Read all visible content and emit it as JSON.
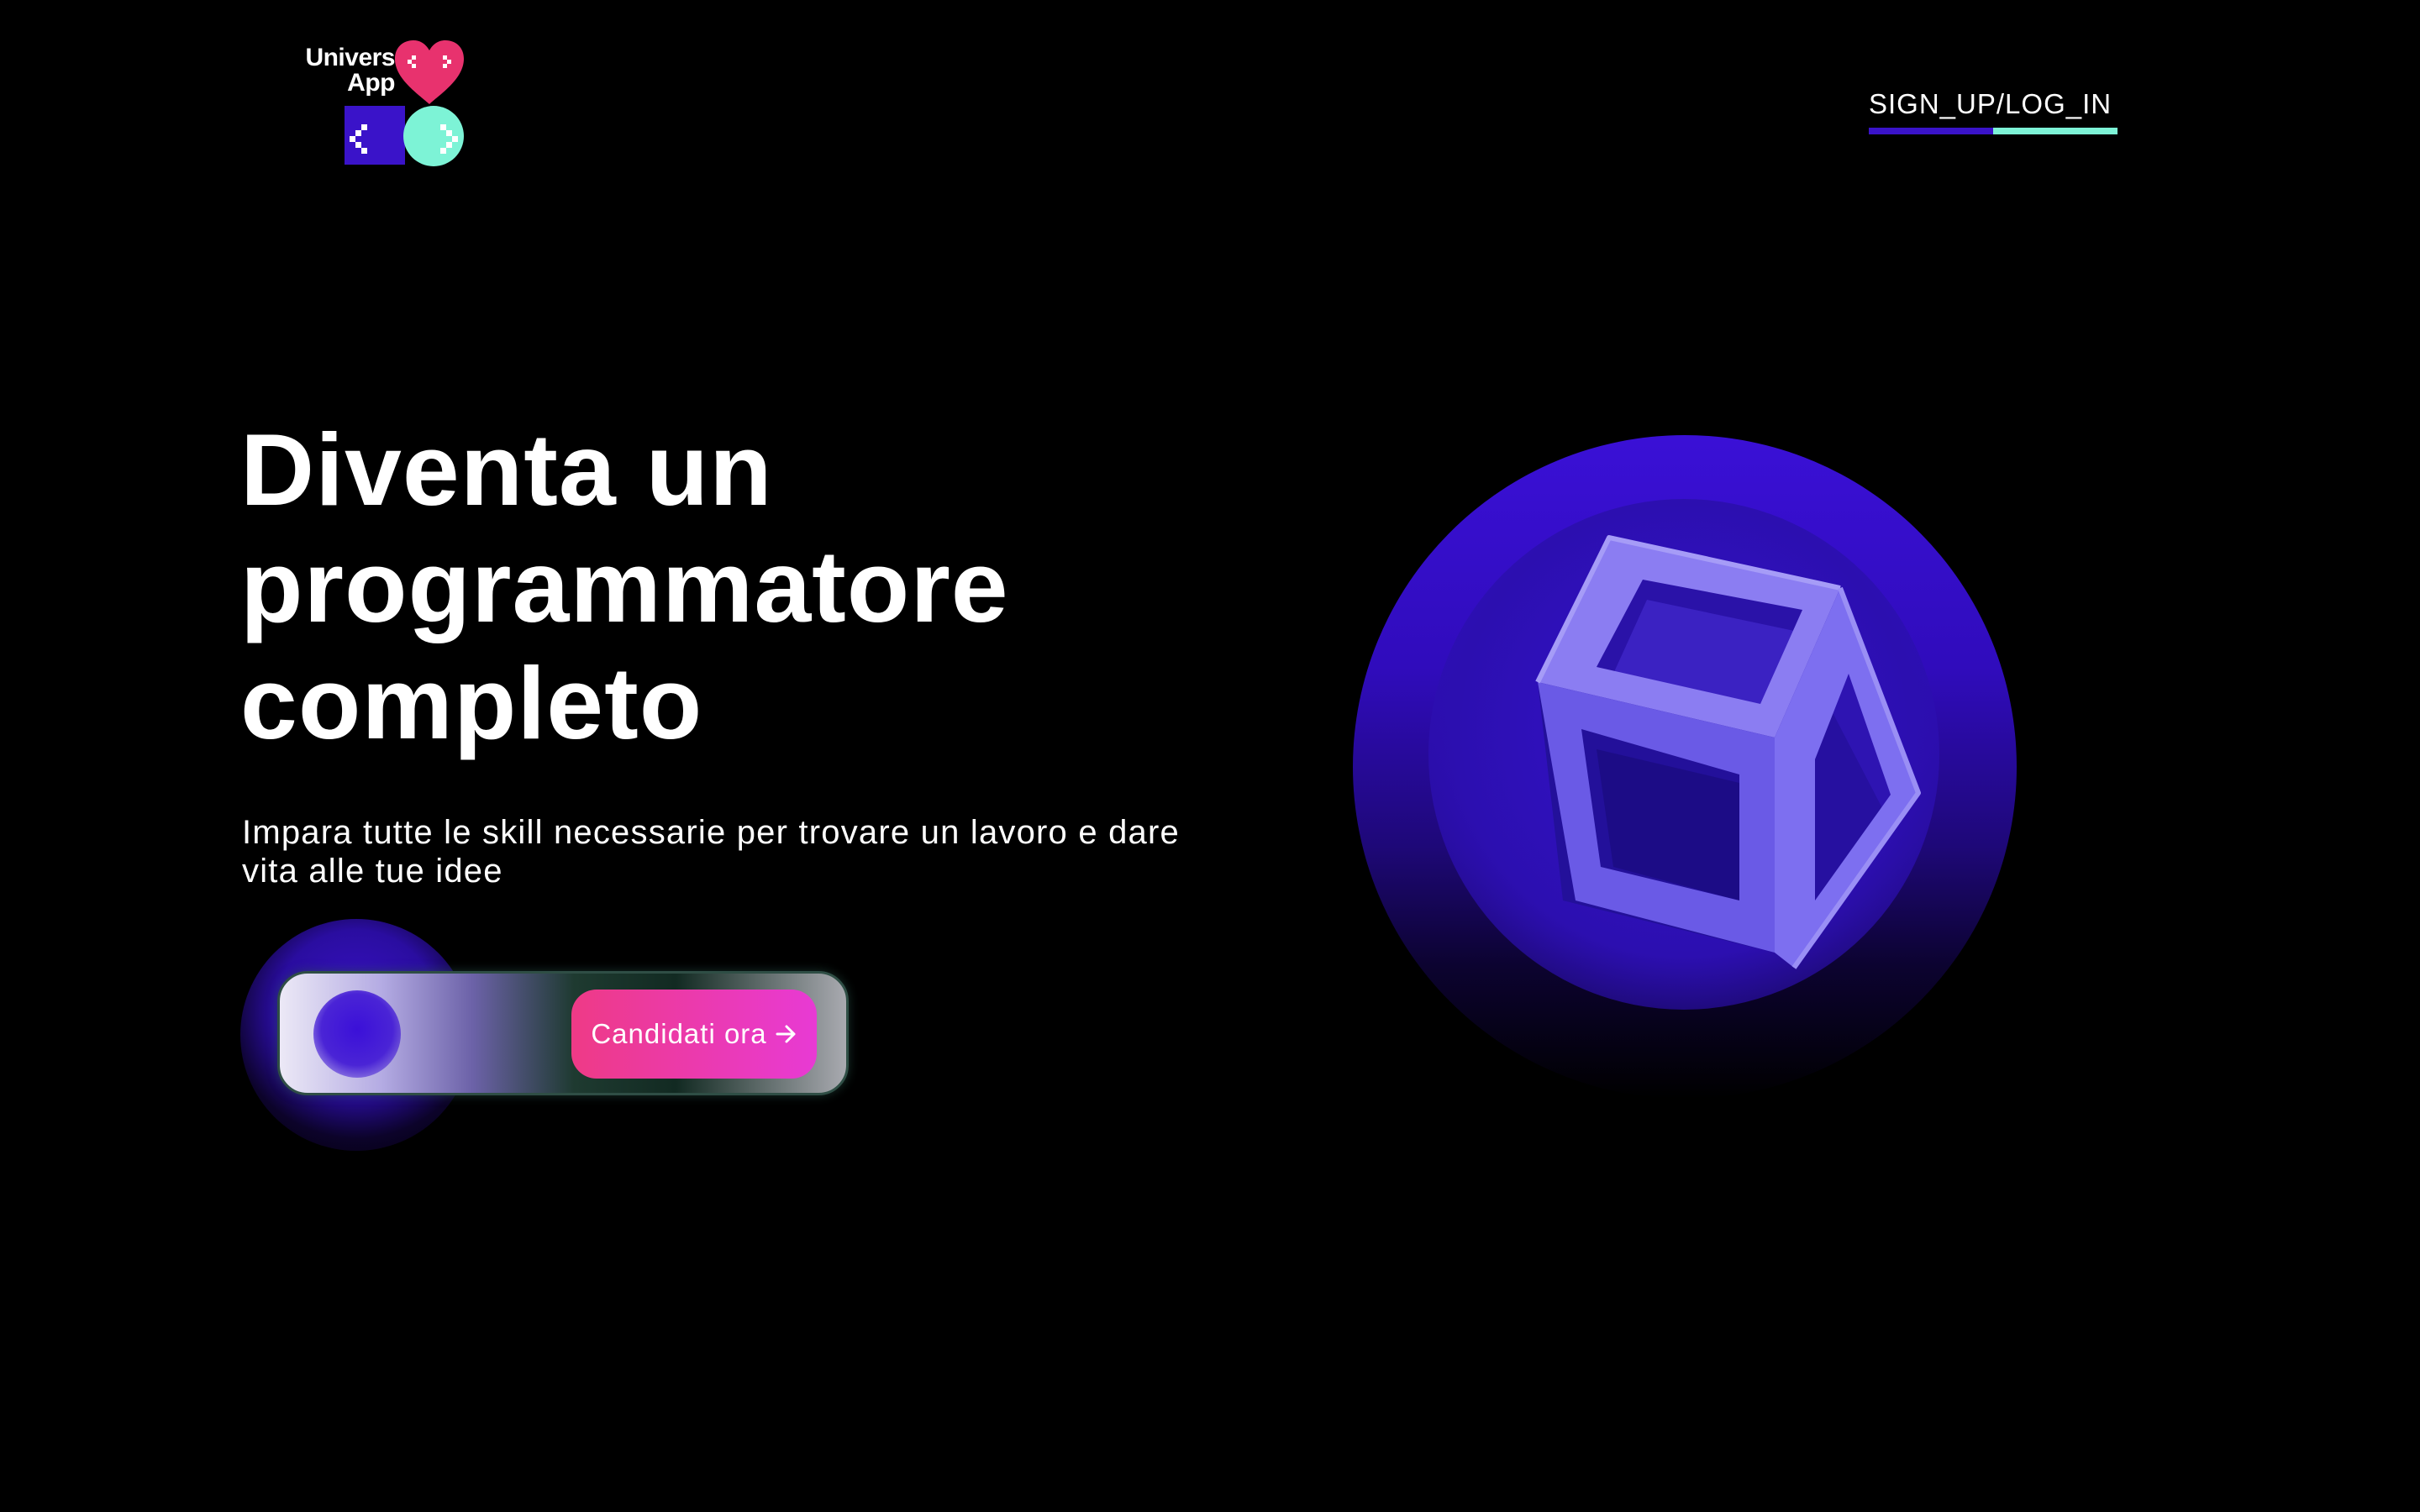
{
  "brand": {
    "logo_line1": "Univers",
    "logo_line2": "App",
    "heart_color": "#e8326e",
    "square_color": "#3a13c9",
    "circle_color": "#7df3d6",
    "icon": "code-brackets-logo"
  },
  "nav": {
    "signup_label": "SIGN_UP/LOG_IN",
    "underline_colors": [
      "#3a13c9",
      "#7df3d6"
    ]
  },
  "hero": {
    "title_lines": [
      "Diventa un",
      "programmatore",
      "completo"
    ],
    "subtitle": "Impara tutte le skill necessarie per trovare un lavoro e dare vita alle tue idee"
  },
  "cta": {
    "button_label": "Candidati ora",
    "arrow_icon": "arrow-right-icon",
    "gradient": [
      "#ee3a86",
      "#e83ad4"
    ]
  },
  "illustration": {
    "icon": "hollow-cube-icon",
    "circle_color": "#3a10d6",
    "cube_color": "#7b6cf0"
  }
}
